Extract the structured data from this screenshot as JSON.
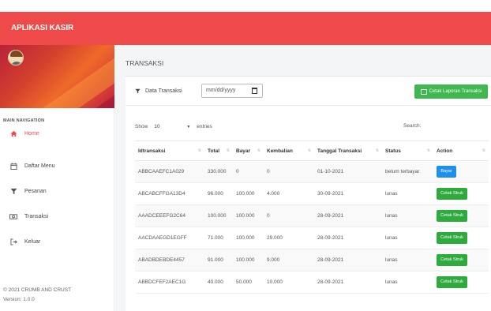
{
  "app": {
    "title": "APLIKASI KASIR"
  },
  "sidebar": {
    "nav_header": "MAIN NAVIGATION",
    "items": [
      {
        "label": "Home",
        "icon": "home-icon"
      },
      {
        "label": "Daftar Menu",
        "icon": "calendar-icon"
      },
      {
        "label": "Pesanan",
        "icon": "filter-icon"
      },
      {
        "label": "Transaksi",
        "icon": "money-icon"
      },
      {
        "label": "Keluar",
        "icon": "sign-out-icon"
      }
    ],
    "footer_line1": "© 2021 CRUMB AND CRUST",
    "footer_line2": "Version: 1.0.0"
  },
  "page": {
    "title": "TRANSAKSI"
  },
  "filter": {
    "label": "Data Transaksi",
    "date_placeholder": "mm/dd/yyyy",
    "print_report_label": "Cetak Laporan Transaksi"
  },
  "table_controls": {
    "show_label": "Show",
    "entries_value": "10",
    "entries_label": "entries",
    "search_label": "Search:"
  },
  "table": {
    "columns": [
      "Idtransaksi",
      "Total",
      "Bayar",
      "Kembalian",
      "Tanggal Transaksi",
      "Status",
      "Action"
    ],
    "rows": [
      {
        "id": "ABBCAAEFC1A029",
        "total": "330.000",
        "bayar": "0",
        "kembalian": "0",
        "tanggal": "01-10-2021",
        "status": "belum terbayar",
        "action": "Bayar",
        "action_type": "pay"
      },
      {
        "id": "ABCABCFFGA13D4",
        "total": "96.000",
        "bayar": "100.000",
        "kembalian": "4.000",
        "tanggal": "30-09-2021",
        "status": "lunas",
        "action": "Cetak Struk",
        "action_type": "print"
      },
      {
        "id": "AAADCEEEFG2C64",
        "total": "100.000",
        "bayar": "100.000",
        "kembalian": "0",
        "tanggal": "28-09-2021",
        "status": "lunas",
        "action": "Cetak Struk",
        "action_type": "print"
      },
      {
        "id": "AACDAAEGD1EGFF",
        "total": "71.000",
        "bayar": "100.000",
        "kembalian": "29.000",
        "tanggal": "28-09-2021",
        "status": "lunas",
        "action": "Cetak Struk",
        "action_type": "print"
      },
      {
        "id": "ABADBDEBDE4457",
        "total": "91.000",
        "bayar": "100.000",
        "kembalian": "9.000",
        "tanggal": "28-09-2021",
        "status": "lunas",
        "action": "Cetak Struk",
        "action_type": "print"
      },
      {
        "id": "ABBDCFEF2AEC1G",
        "total": "40.000",
        "bayar": "50.000",
        "kembalian": "10.000",
        "tanggal": "28-09-2021",
        "status": "lunas",
        "action": "Cetak Struk",
        "action_type": "print"
      }
    ]
  },
  "colors": {
    "brand_red": "#ef4a4a",
    "success_green": "#2eaa3f",
    "pay_blue": "#1e90ea"
  }
}
